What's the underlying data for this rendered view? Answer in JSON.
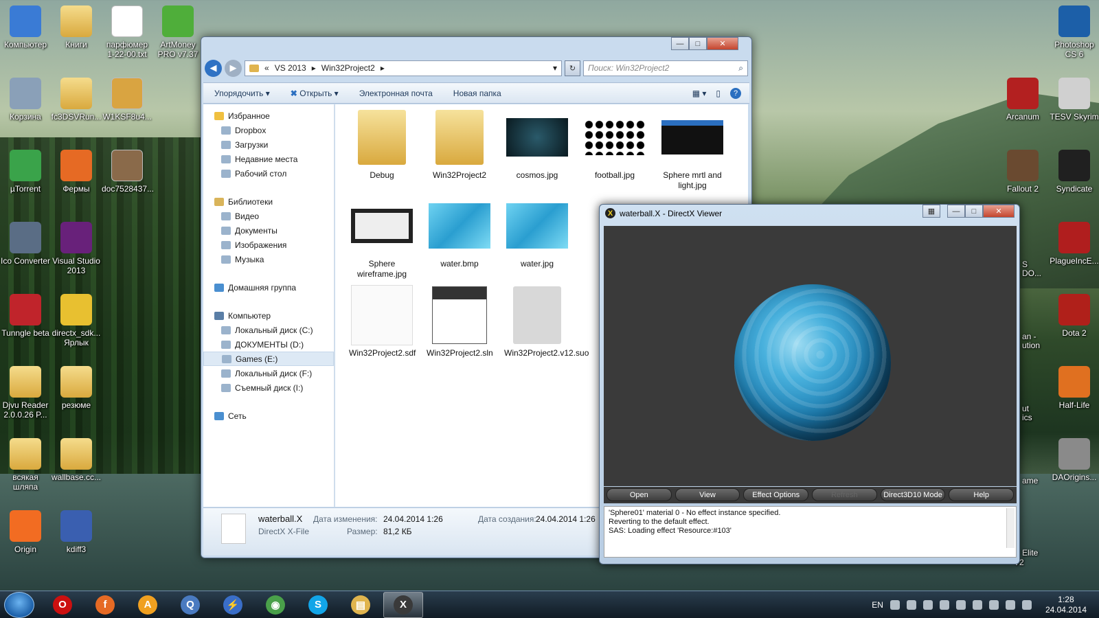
{
  "desktop": {
    "left_icons": [
      {
        "label": "Компьютер",
        "icon": "computer-icon",
        "color": "#3a7bd5"
      },
      {
        "label": "Книги",
        "icon": "folder-icon",
        "color": "#e0b44e"
      },
      {
        "label": "парфюмер 1-22-00.txt",
        "icon": "text-file-icon",
        "color": "#ffffff"
      },
      {
        "label": "ArtMoney PRO v7.37",
        "icon": "artmoney-icon",
        "color": "#4fae3a"
      },
      {
        "label": "Корзина",
        "icon": "recycle-bin-icon",
        "color": "#8aa0b8"
      },
      {
        "label": "fc3DSVRun...",
        "icon": "folder-icon",
        "color": "#e0b44e"
      },
      {
        "label": "W1KSF8u4...",
        "icon": "image-file-icon",
        "color": "#d9a441"
      },
      {
        "label": "µTorrent",
        "icon": "utorrent-icon",
        "color": "#3aa34a"
      },
      {
        "label": "Фермы",
        "icon": "firefox-doc-icon",
        "color": "#e66a24"
      },
      {
        "label": "doc7528437...",
        "icon": "image-file-icon",
        "color": "#8a6a4a"
      },
      {
        "label": "Ico Converter",
        "icon": "ico-converter-icon",
        "color": "#5a6d85"
      },
      {
        "label": "Visual Studio 2013",
        "icon": "visual-studio-icon",
        "color": "#68217a"
      },
      {
        "label": "Tunngle beta",
        "icon": "tunngle-icon",
        "color": "#c0242b"
      },
      {
        "label": "directx_sdk... Ярлык",
        "icon": "directx-sdk-icon",
        "color": "#e8c030"
      },
      {
        "label": "Djvu Reader 2.0.0.26 P...",
        "icon": "folder-icon",
        "color": "#e0b44e"
      },
      {
        "label": "резюме",
        "icon": "folder-icon",
        "color": "#e0b44e"
      },
      {
        "label": "всякая шляпа",
        "icon": "folder-icon",
        "color": "#e0b44e"
      },
      {
        "label": "wallbase.cc...",
        "icon": "folder-icon",
        "color": "#e0b44e"
      },
      {
        "label": "Origin",
        "icon": "origin-icon",
        "color": "#f26c22"
      },
      {
        "label": "kdiff3",
        "icon": "kdiff3-icon",
        "color": "#3a5fb0"
      }
    ],
    "right_icons": [
      {
        "label": "Photoshop CS 6",
        "icon": "photoshop-icon",
        "color": "#1c5fa8"
      },
      {
        "label": "Arcanum",
        "icon": "arcanum-icon",
        "color": "#b32020"
      },
      {
        "label": "TESV Skyrim",
        "icon": "skyrim-icon",
        "color": "#d0d0d0"
      },
      {
        "label": "Fallout 2",
        "icon": "fallout-icon",
        "color": "#6a4a30"
      },
      {
        "label": "Syndicate",
        "icon": "syndicate-icon",
        "color": "#202020"
      },
      {
        "label": "PlagueIncE...",
        "icon": "plague-icon",
        "color": "#b01e1e"
      },
      {
        "label": "Dota 2",
        "icon": "dota-icon",
        "color": "#b0201a"
      },
      {
        "label": "Half-Life",
        "icon": "half-life-icon",
        "color": "#e07020"
      },
      {
        "label": "DAOrigins...",
        "icon": "dragon-age-icon",
        "color": "#8a8a8a"
      }
    ],
    "partial_labels": [
      "S",
      "DO...",
      "an -",
      "ution",
      "ut",
      "ics",
      "ame",
      "Elite",
      "V2"
    ]
  },
  "explorer": {
    "window_controls": {
      "minimize": "—",
      "maximize": "□",
      "close": "✕"
    },
    "breadcrumb": [
      "VS 2013",
      "Win32Project2"
    ],
    "search_placeholder": "Поиск: Win32Project2",
    "toolbar": {
      "organize": "Упорядочить",
      "open": "Открыть",
      "email": "Электронная почта",
      "new_folder": "Новая папка"
    },
    "nav": {
      "favorites": {
        "title": "Избранное",
        "items": [
          "Dropbox",
          "Загрузки",
          "Недавние места",
          "Рабочий стол"
        ]
      },
      "libraries": {
        "title": "Библиотеки",
        "items": [
          "Видео",
          "Документы",
          "Изображения",
          "Музыка"
        ]
      },
      "homegroup": "Домашняя группа",
      "computer": {
        "title": "Компьютер",
        "items": [
          "Локальный диск (C:)",
          "ДОКУМЕНТЫ (D:)",
          "Games (E:)",
          "Локальный диск (F:)",
          "Съемный диск (I:)"
        ],
        "selected": "Games (E:)"
      },
      "network": "Сеть"
    },
    "files": [
      {
        "name": "Debug",
        "type": "folder"
      },
      {
        "name": "Win32Project2",
        "type": "folder-cpp"
      },
      {
        "name": "cosmos.jpg",
        "type": "image-dark"
      },
      {
        "name": "football.jpg",
        "type": "image-dots"
      },
      {
        "name": "Sphere mrtl and light.jpg",
        "type": "image-screenshot"
      },
      {
        "name": "Sphere wireframe.jpg",
        "type": "image-screenshot-light"
      },
      {
        "name": "water.bmp",
        "type": "image-water"
      },
      {
        "name": "water.jpg",
        "type": "image-water"
      },
      {
        "name": "Win32Project2.sdf",
        "type": "sdf"
      },
      {
        "name": "Win32Project2.sln",
        "type": "sln"
      },
      {
        "name": "Win32Project2.v12.suo",
        "type": "suo"
      }
    ],
    "status": {
      "filename": "waterball.X",
      "filetype": "DirectX X-File",
      "modified_label": "Дата изменения:",
      "modified_value": "24.04.2014 1:26",
      "created_label": "Дата создания:",
      "created_value": "24.04.2014 1:26",
      "size_label": "Размер:",
      "size_value": "81,2 КБ"
    }
  },
  "dxviewer": {
    "title": "waterball.X - DirectX Viewer",
    "buttons": [
      "Open",
      "View",
      "Effect Options",
      "Refresh",
      "Direct3D10 Mode",
      "Help"
    ],
    "disabled_button": "Refresh",
    "log": [
      "'Sphere01' material 0 - No effect instance specified.",
      "Reverting to the default effect.",
      "SAS: Loading effect 'Resource:#103'"
    ]
  },
  "taskbar": {
    "items": [
      {
        "icon": "opera-icon",
        "color": "#cc1010",
        "glyph": "O"
      },
      {
        "icon": "firefox-icon",
        "color": "#e66a24",
        "glyph": "f"
      },
      {
        "icon": "aimp-icon",
        "color": "#f0a020",
        "glyph": "A"
      },
      {
        "icon": "quicktime-icon",
        "color": "#4a7ac0",
        "glyph": "Q"
      },
      {
        "icon": "lightning-icon",
        "color": "#3a6ec8",
        "glyph": "⚡"
      },
      {
        "icon": "chrome-icon",
        "color": "#4aa04a",
        "glyph": "◉"
      },
      {
        "icon": "skype-icon",
        "color": "#12a5e8",
        "glyph": "S"
      },
      {
        "icon": "explorer-icon",
        "color": "#e0b44e",
        "glyph": "▤"
      },
      {
        "icon": "directx-icon",
        "color": "#3a3a3a",
        "glyph": "X"
      }
    ],
    "active_item": "directx-icon",
    "language": "EN",
    "time": "1:28",
    "date": "24.04.2014"
  }
}
